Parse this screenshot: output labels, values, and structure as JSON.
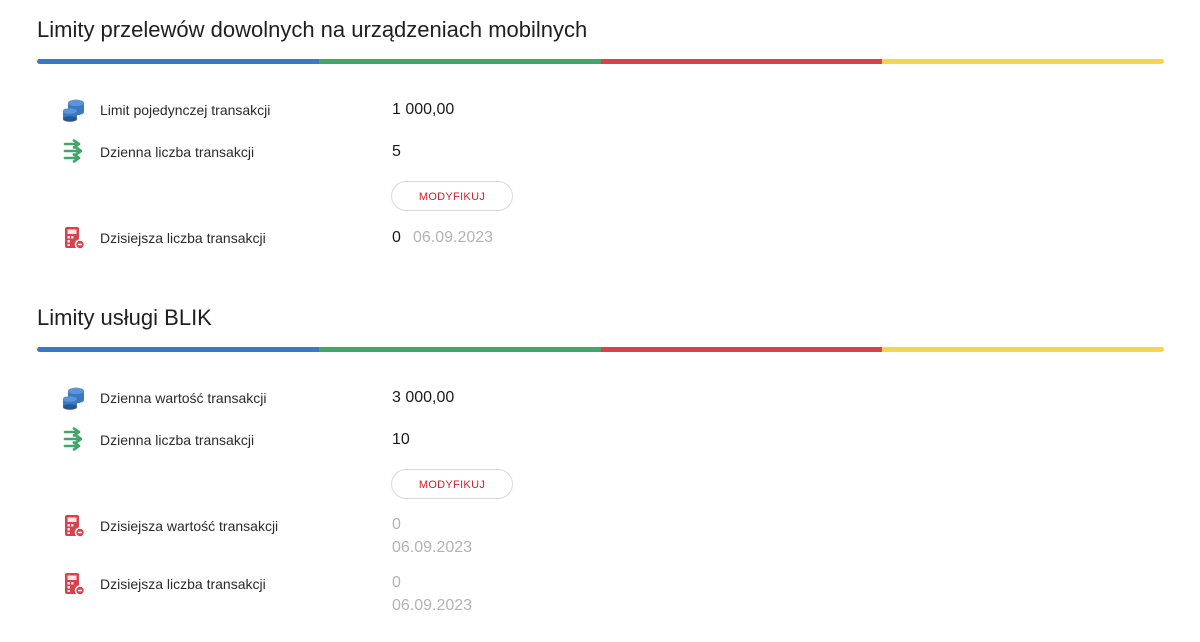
{
  "colors": {
    "blue": "#3b78c4",
    "green": "#42a66a",
    "red": "#d9414f",
    "yellow": "#f5d54a",
    "accent_red": "#d2232a"
  },
  "icons": {
    "coins": "coins-icon",
    "arrows": "transfer-arrows-icon",
    "calculator": "calculator-icon"
  },
  "mobile": {
    "title": "Limity przelewów dowolnych na urządzeniach mobilnych",
    "rows": [
      {
        "label": "Limit pojedynczej transakcji",
        "value": "1 000,00"
      },
      {
        "label": "Dzienna liczba transakcji",
        "value": "5"
      }
    ],
    "modify_label": "MODYFIKUJ",
    "today": {
      "label": "Dzisiejsza liczba transakcji",
      "value": "0",
      "date": "06.09.2023"
    }
  },
  "blik": {
    "title": "Limity usługi BLIK",
    "rows": [
      {
        "label": "Dzienna wartość transakcji",
        "value": "3 000,00"
      },
      {
        "label": "Dzienna liczba transakcji",
        "value": "10"
      }
    ],
    "modify_label": "MODYFIKUJ",
    "today_value": {
      "label": "Dzisiejsza wartość transakcji",
      "value": "0",
      "date": "06.09.2023"
    },
    "today_count": {
      "label": "Dzisiejsza liczba transakcji",
      "value": "0",
      "date": "06.09.2023"
    }
  }
}
